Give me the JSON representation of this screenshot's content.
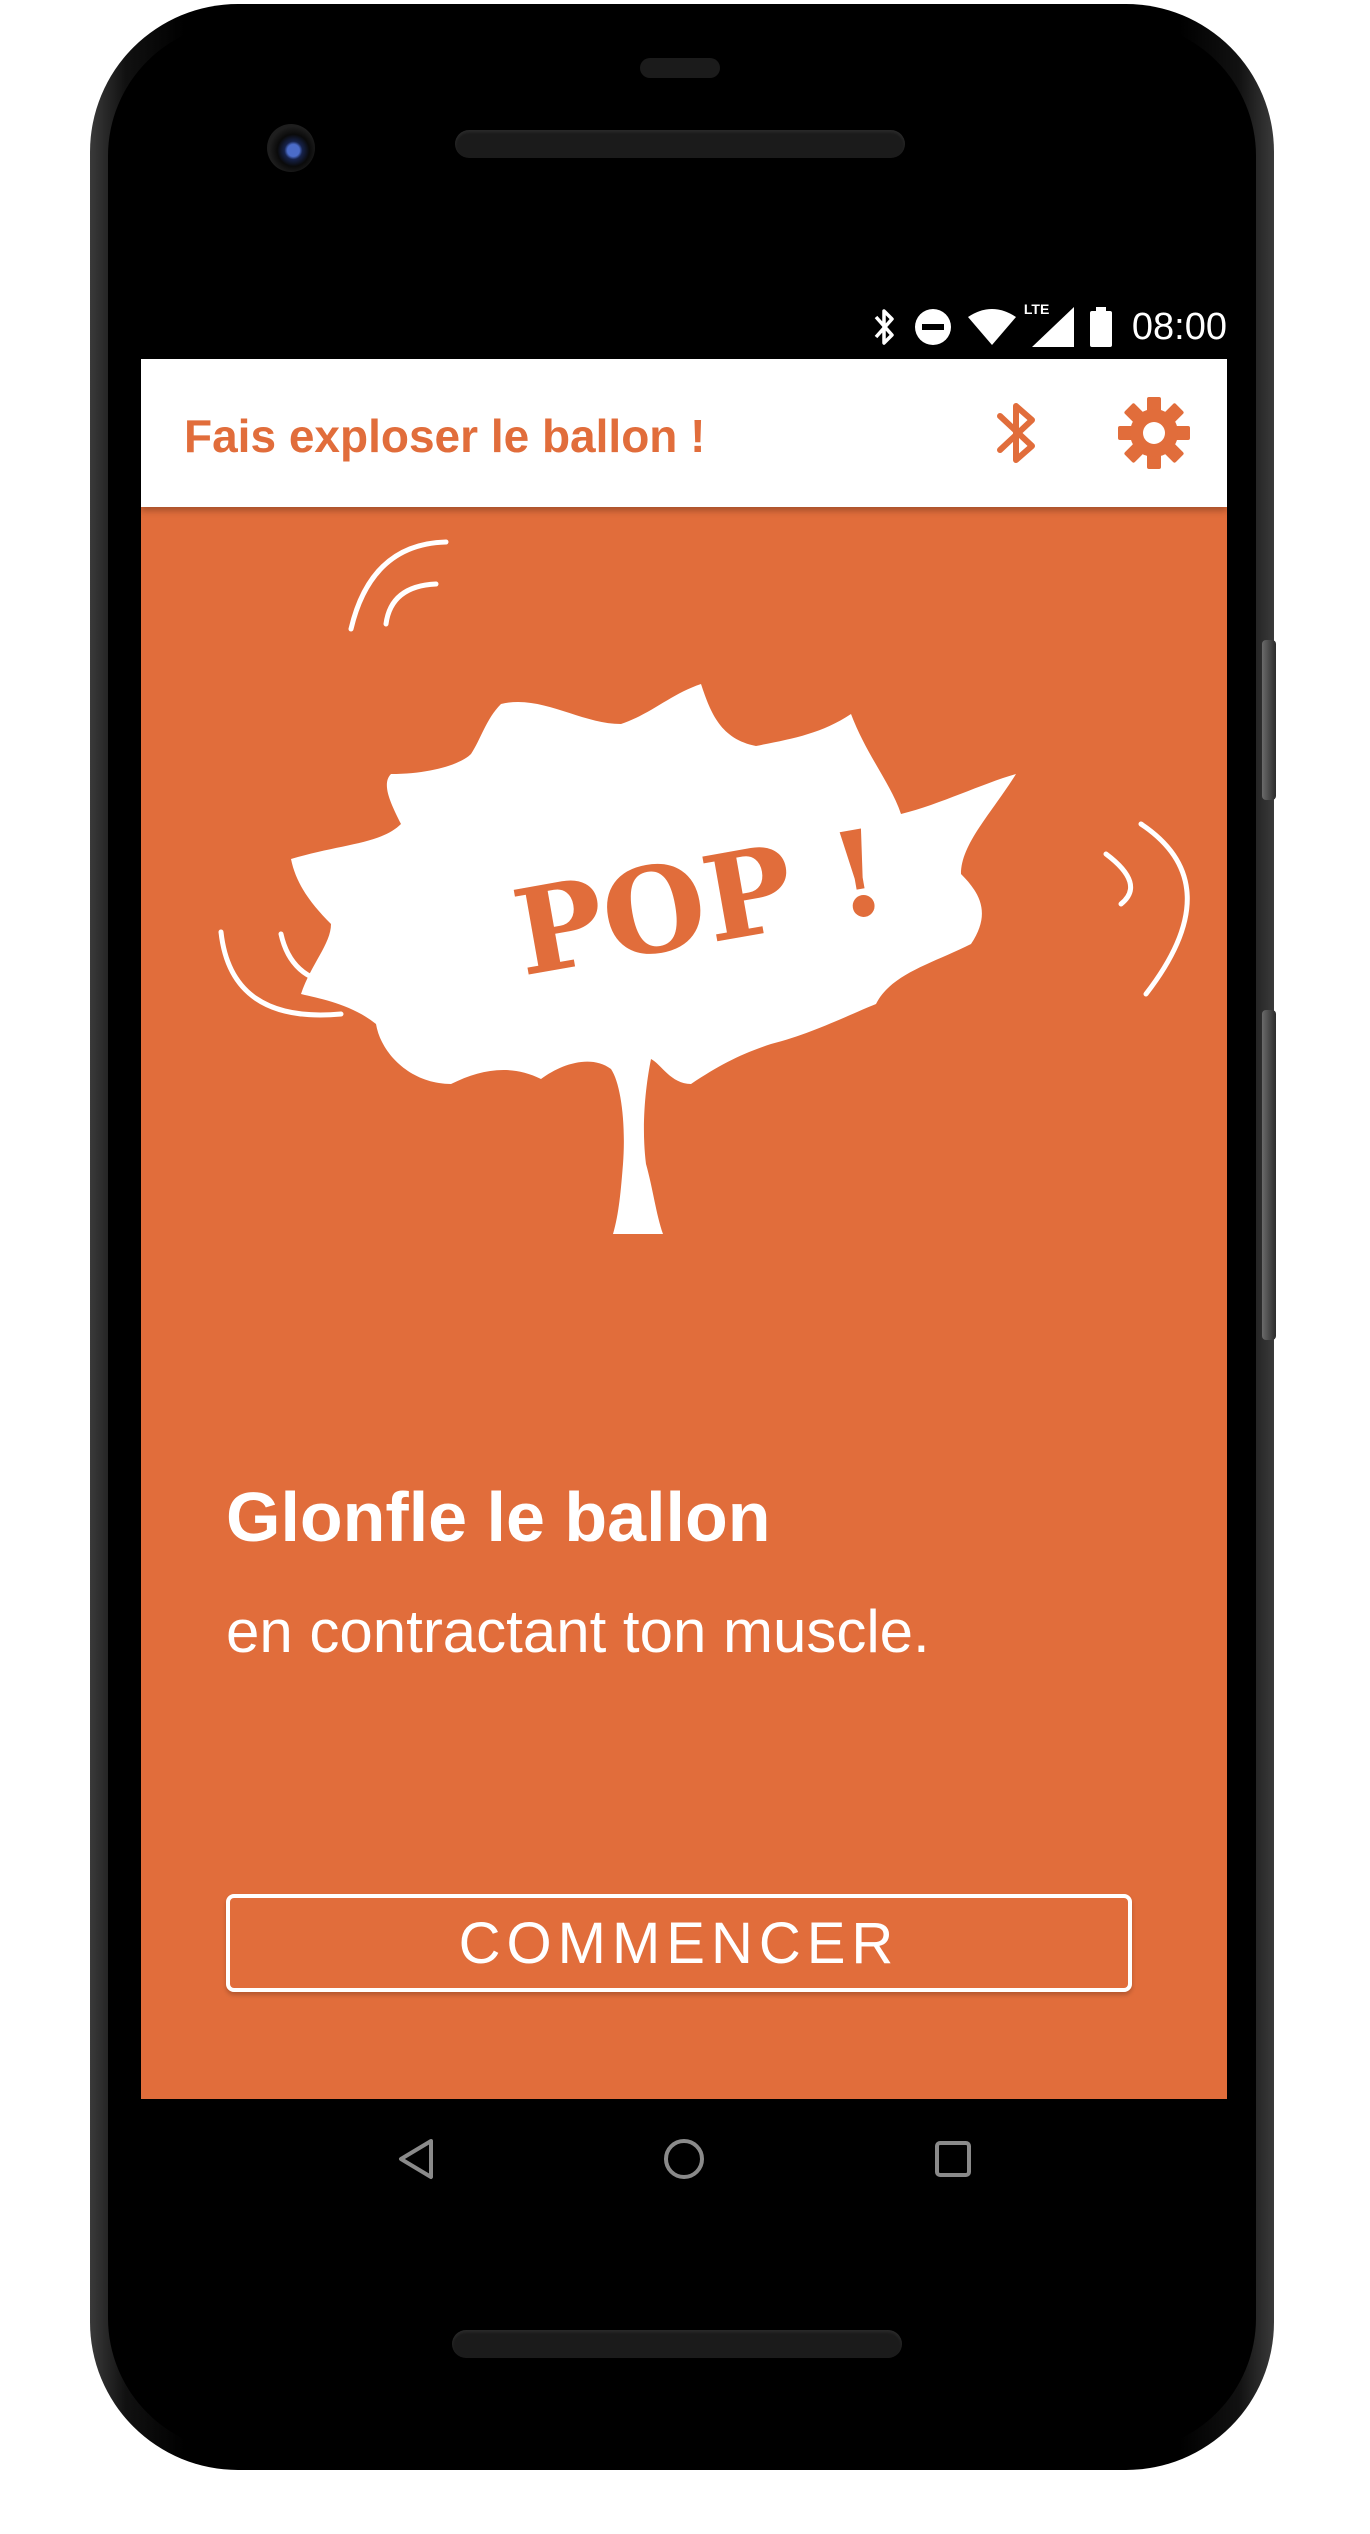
{
  "status_bar": {
    "time": "08:00",
    "icons": [
      "bluetooth-icon",
      "do-not-disturb-icon",
      "wifi-icon",
      "lte-signal-icon",
      "battery-icon"
    ],
    "lte_label": "LTE"
  },
  "app_bar": {
    "title": "Fais exploser le ballon !",
    "actions": [
      "bluetooth-icon",
      "settings-gear-icon"
    ]
  },
  "illustration": {
    "pop_text": "POP !"
  },
  "main": {
    "heading": "Glonfle le ballon",
    "subtext": "en contractant ton muscle.",
    "start_button_label": "COMMENCER"
  },
  "nav_bar": {
    "buttons": [
      "back-icon",
      "home-icon",
      "recents-icon"
    ]
  },
  "colors": {
    "accent": "#e16d3b",
    "surface": "#ffffff",
    "background": "#000000"
  }
}
